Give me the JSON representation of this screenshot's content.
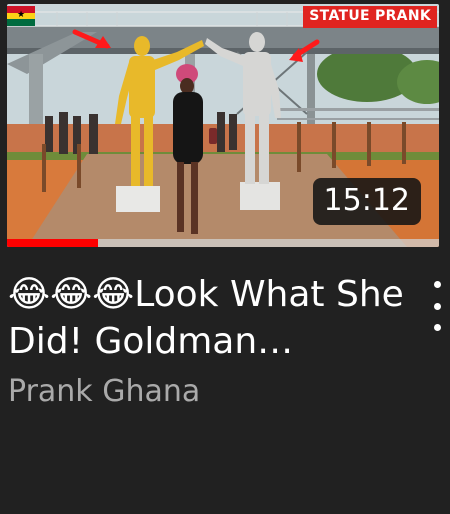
{
  "video": {
    "thumbnail_overlay_text": "STATUE PRANK",
    "duration": "15:12",
    "watch_progress_percent": 21,
    "title": "😂😂😂Look What She Did! Goldman Reaction",
    "channel": "Prank Ghana"
  },
  "icons": {
    "flag": "ghana-flag-icon",
    "menu": "more-vert-icon"
  },
  "colors": {
    "background": "#212121",
    "progress": "#ff0000",
    "overlay_label": "#e02420",
    "channel_text": "#aaaaaa",
    "flag_red": "#ce1126",
    "flag_gold": "#fcd116",
    "flag_green": "#006b3f"
  }
}
